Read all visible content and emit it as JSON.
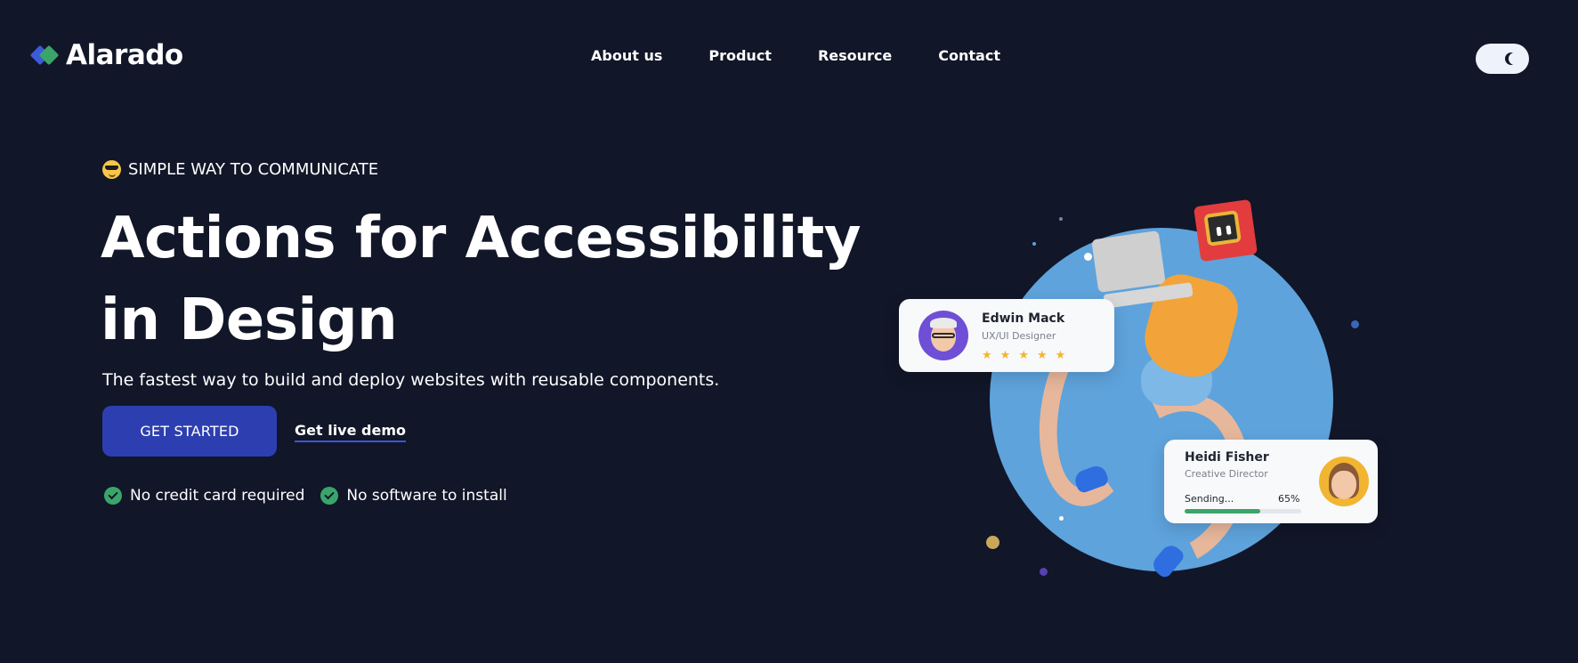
{
  "brand": {
    "name": "Alarado",
    "colors": {
      "primary": "#2d3fb0",
      "accent_green": "#3aa56b",
      "background": "#111628"
    }
  },
  "nav": {
    "items": [
      "About us",
      "Product",
      "Resource",
      "Contact"
    ]
  },
  "theme_toggle": {
    "icon": "moon-icon",
    "mode": "dark"
  },
  "hero": {
    "tagline": "SIMPLE WAY TO COMMUNICATE",
    "tagline_icon": "sunglasses-emoji-icon",
    "headline": "Actions for Accessibility in Design",
    "subtitle": "The fastest way to build and deploy websites with reusable components.",
    "cta_primary": "GET STARTED",
    "cta_secondary": "Get live demo",
    "checks": [
      "No credit card required",
      "No software to install"
    ]
  },
  "cards": {
    "edwin": {
      "name": "Edwin Mack",
      "role": "UX/UI Designer",
      "rating": 5,
      "star_glyph": "★"
    },
    "heidi": {
      "name": "Heidi Fisher",
      "role": "Creative Director",
      "status": "Sending...",
      "progress_label": "65%",
      "progress": 0.65
    }
  }
}
